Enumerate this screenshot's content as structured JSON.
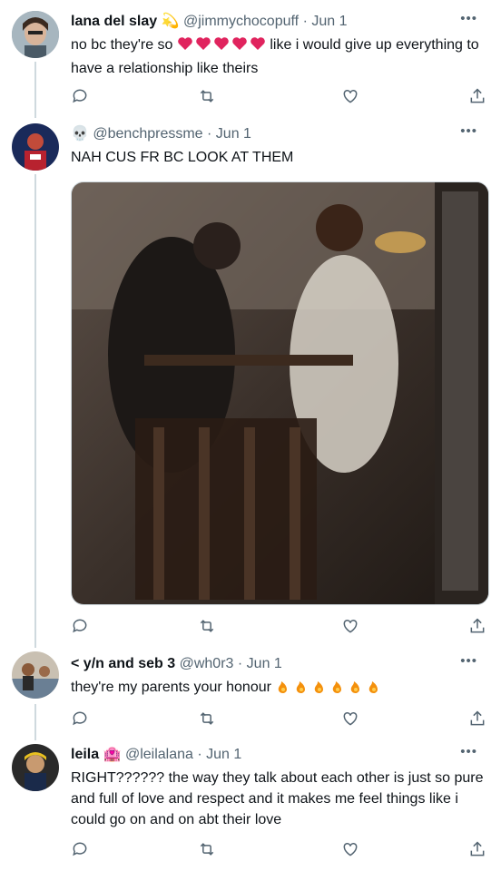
{
  "tweets": [
    {
      "name": "lana del slay",
      "handle": "@jimmychocopuff",
      "date": "· Jun 1",
      "text_before": "no bc they're so",
      "text_after": " like i would give up everything to have a relationship like theirs"
    },
    {
      "name": "",
      "handle": "@benchpressme",
      "date": "· Jun 1",
      "text": "NAH CUS FR BC LOOK AT THEM"
    },
    {
      "name": "< y/n and seb 3",
      "handle": "@wh0r3",
      "date": "· Jun 1",
      "text": "they're my parents your honour"
    },
    {
      "name": "leila",
      "handle": "@leilalana",
      "date": "· Jun 1",
      "text": "RIGHT?????? the way they talk about each other is just so pure and full of love and respect and it makes me feel things like i could go on and on abt their love"
    }
  ],
  "more_label": "•••",
  "icons": [
    "reply-icon",
    "retweet-icon",
    "like-icon",
    "share-icon"
  ],
  "colors": {
    "text": "#0f1419",
    "secondary": "#536471",
    "thread_line": "#cfd9de",
    "heart": "#e0245e",
    "fire": "#f4900c"
  }
}
